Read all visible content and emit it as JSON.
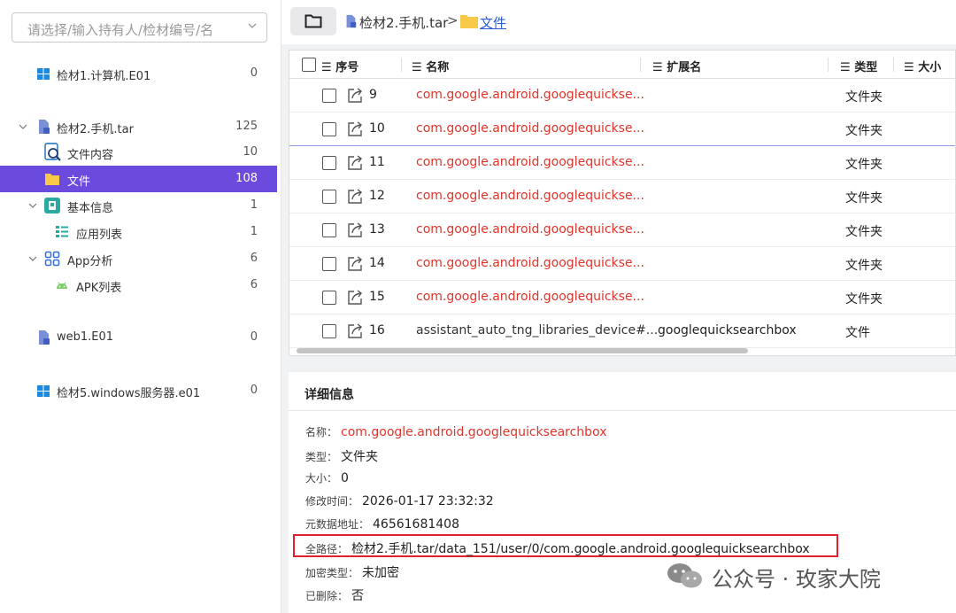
{
  "search": {
    "placeholder": "请选择/输入持有人/检材编号/名"
  },
  "tree": [
    {
      "label": "检材1.计算机.E01",
      "count": "0"
    },
    {
      "label": "检材2.手机.tar",
      "count": "125"
    },
    {
      "label": "文件内容",
      "count": "10"
    },
    {
      "label": "文件",
      "count": "108"
    },
    {
      "label": "基本信息",
      "count": "1"
    },
    {
      "label": "应用列表",
      "count": "1"
    },
    {
      "label": "App分析",
      "count": "6"
    },
    {
      "label": "APK列表",
      "count": "6"
    },
    {
      "label": "web1.E01",
      "count": "0"
    },
    {
      "label": "检材5.windows服务器.e01",
      "count": "0"
    }
  ],
  "breadcrumb": {
    "root": "检材2.手机.tar",
    "sep": ">",
    "current": "文件"
  },
  "grid": {
    "headers": {
      "index": "序号",
      "name": "名称",
      "ext": "扩展名",
      "type": "类型",
      "size": "大小"
    },
    "rows": [
      {
        "num": "9",
        "name": "com.google.android.googlequickse...",
        "ext": "",
        "type": "文件夹"
      },
      {
        "num": "10",
        "name": "com.google.android.googlequickse...",
        "ext": "",
        "type": "文件夹"
      },
      {
        "num": "11",
        "name": "com.google.android.googlequickse...",
        "ext": "",
        "type": "文件夹"
      },
      {
        "num": "12",
        "name": "com.google.android.googlequickse...",
        "ext": "",
        "type": "文件夹"
      },
      {
        "num": "13",
        "name": "com.google.android.googlequickse...",
        "ext": "",
        "type": "文件夹"
      },
      {
        "num": "14",
        "name": "com.google.android.googlequickse...",
        "ext": "",
        "type": "文件夹"
      },
      {
        "num": "15",
        "name": "com.google.android.googlequickse...",
        "ext": "",
        "type": "文件夹"
      },
      {
        "num": "16",
        "name": "assistant_auto_tng_libraries_device#...",
        "ext": "googlequicksearchbox",
        "type": "文件"
      }
    ]
  },
  "detail": {
    "title": "详细信息",
    "fields": [
      {
        "key": "名称：",
        "value": "com.google.android.googlequicksearchbox"
      },
      {
        "key": "类型：",
        "value": "文件夹"
      },
      {
        "key": "大小：",
        "value": "0"
      },
      {
        "key": "修改时间：",
        "value": "2026-01-17 23:32:32"
      },
      {
        "key": "元数据地址：",
        "value": "46561681408"
      },
      {
        "key": "全路径：",
        "value": "检材2.手机.tar/data_151/user/0/com.google.android.googlequicksearchbox"
      },
      {
        "key": "加密类型：",
        "value": "未加密"
      },
      {
        "key": "已删除：",
        "value": "否"
      }
    ]
  },
  "watermark": "公众号 · 玫家大院",
  "colors": {
    "accent": "#6b4bdd",
    "red_text": "#e0352b",
    "highlight_box": "#e0202a"
  }
}
